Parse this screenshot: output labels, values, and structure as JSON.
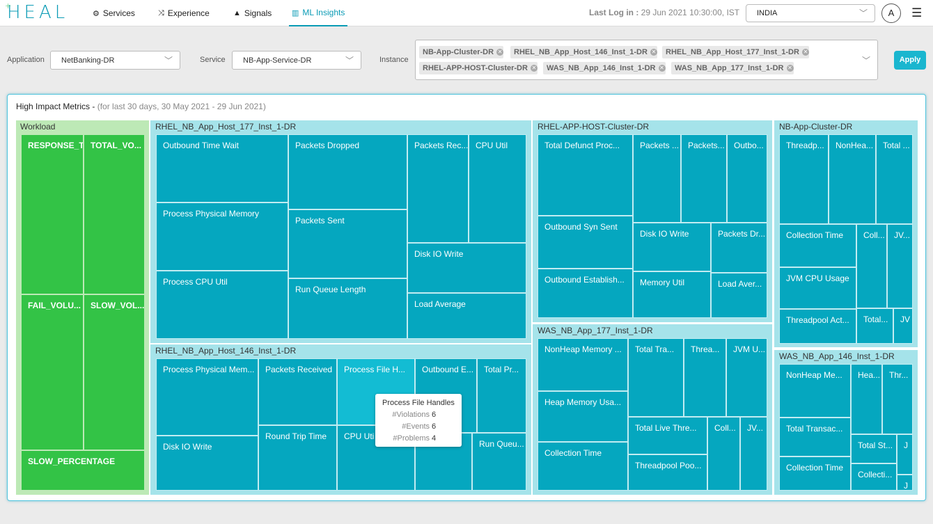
{
  "app": {
    "logo_text": "HEAL",
    "logo_mark": "+"
  },
  "nav": [
    {
      "label": "Services",
      "icon": "gears-icon"
    },
    {
      "label": "Experience",
      "icon": "shuffle-icon"
    },
    {
      "label": "Signals",
      "icon": "warning-icon"
    },
    {
      "label": "ML Insights",
      "icon": "bar-chart-icon",
      "active": true
    }
  ],
  "header": {
    "last_login_label": "Last Log in :",
    "last_login_value": "29 Jun 2021 10:30:00, IST",
    "country": "INDIA",
    "avatar": "A"
  },
  "filters": {
    "application_label": "Application",
    "application_value": "NetBanking-DR",
    "service_label": "Service",
    "service_value": "NB-App-Service-DR",
    "instance_label": "Instance",
    "instances": [
      "NB-App-Cluster-DR",
      "RHEL_NB_App_Host_146_Inst_1-DR",
      "RHEL_NB_App_Host_177_Inst_1-DR",
      "RHEL-APP-HOST-Cluster-DR",
      "WAS_NB_App_146_Inst_1-DR",
      "WAS_NB_App_177_Inst_1-DR"
    ],
    "apply_label": "Apply"
  },
  "panel": {
    "title": "High Impact Metrics - ",
    "subtitle": "(for last 30 days, 30 May 2021 - 29 Jun 2021)"
  },
  "colors": {
    "cell": "#05a7bf",
    "cell_highlight": "#13bcd3",
    "group_bg": "#a5e3ea",
    "workload_cell": "#33c346",
    "workload_bg": "#bde9b6",
    "accent": "#0a9bb5"
  },
  "treemap": {
    "workload": {
      "label": "Workload",
      "cells": [
        "RESPONSE_T...",
        "TOTAL_VO...",
        "FAIL_VOLU...",
        "SLOW_VOL...",
        "SLOW_PERCENTAGE"
      ]
    },
    "host177": {
      "label": "RHEL_NB_App_Host_177_Inst_1-DR",
      "cells": [
        "Outbound Time Wait",
        "Packets Dropped",
        "Packets Rec...",
        "CPU Util",
        "Process Physical Memory",
        "Packets Sent",
        "Disk IO Write",
        "Process CPU Util",
        "Run Queue Length",
        "Load Average"
      ]
    },
    "host146": {
      "label": "RHEL_NB_App_Host_146_Inst_1-DR",
      "cells": [
        "Process Physical Mem...",
        "Packets Received",
        "Process File H...",
        "Outbound E...",
        "Total Pr...",
        "Disk IO Write",
        "Round Trip Time",
        "CPU Uti",
        "",
        "Run Queu..."
      ]
    },
    "rhelcluster": {
      "label": "RHEL-APP-HOST-Cluster-DR",
      "cells": [
        "Total Defunct Proc...",
        "Packets ...",
        "Packets...",
        "Outbo...",
        "Outbound Syn Sent",
        "Disk IO Write",
        "Packets Dr...",
        "Outbound Establish...",
        "Memory Util",
        "Load Aver..."
      ]
    },
    "was177": {
      "label": "WAS_NB_App_177_Inst_1-DR",
      "cells": [
        "NonHeap Memory ...",
        "Total Tra...",
        "Threa...",
        "JVM U...",
        "Heap Memory Usa...",
        "Total Live Thre...",
        "Coll...",
        "JV...",
        "Collection Time",
        "Threadpool Poo..."
      ]
    },
    "nbcluster": {
      "label": "NB-App-Cluster-DR",
      "cells": [
        "Threadp...",
        "NonHea...",
        "Total ...",
        "Collection Time",
        "Coll...",
        "JV...",
        "JVM CPU Usage",
        "Threadpool Act...",
        "Total...",
        "JV"
      ]
    },
    "was146": {
      "label": "WAS_NB_App_146_Inst_1-DR",
      "cells": [
        "NonHeap Me...",
        "Hea...",
        "Thr...",
        "Total Transac...",
        "Total St...",
        "J",
        "Collection Time",
        "Collecti...",
        "J"
      ]
    }
  },
  "tooltip": {
    "title": "Process File Handles",
    "rows": [
      {
        "k": "#Violations",
        "v": "6"
      },
      {
        "k": "#Events",
        "v": "6"
      },
      {
        "k": "#Problems",
        "v": "4"
      }
    ]
  }
}
